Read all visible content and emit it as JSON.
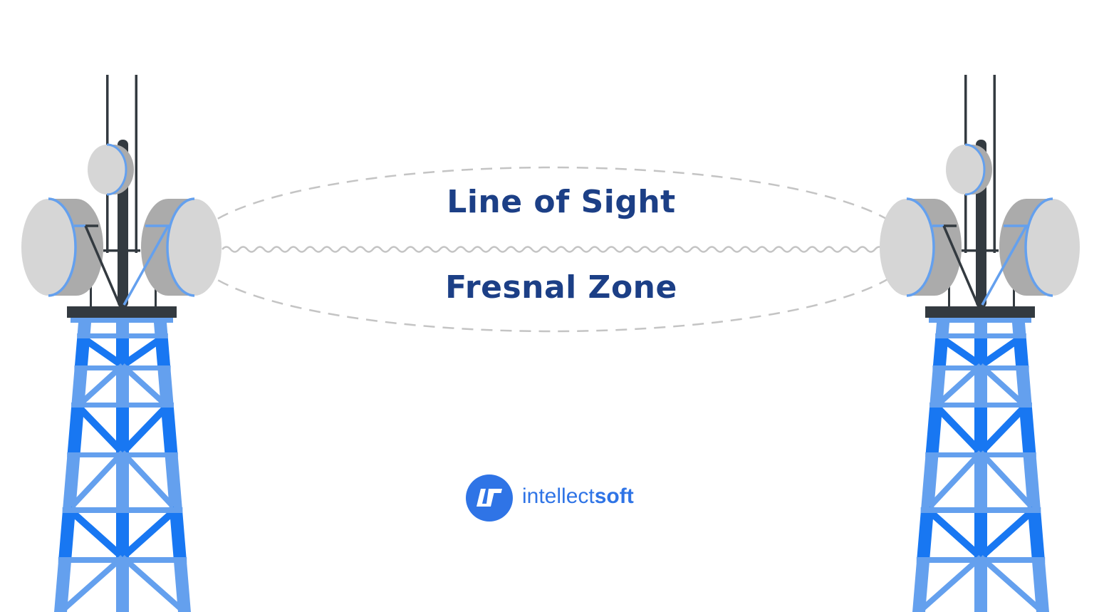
{
  "labels": {
    "line_of_sight": "Line of Sight",
    "fresnel_zone": "Fresnal Zone"
  },
  "logo": {
    "part1": "intellect",
    "part2": "soft",
    "mark": "IS"
  },
  "colors": {
    "tower_dark_blue": "#1877F2",
    "tower_light_blue": "#64A0EE",
    "mast": "#333A40",
    "dish_face": "#D6D6D6",
    "dish_body": "#ABABAB",
    "text": "#1C3F86",
    "logo": "#2F74E6",
    "signal_lines": "#C4C4C4"
  }
}
